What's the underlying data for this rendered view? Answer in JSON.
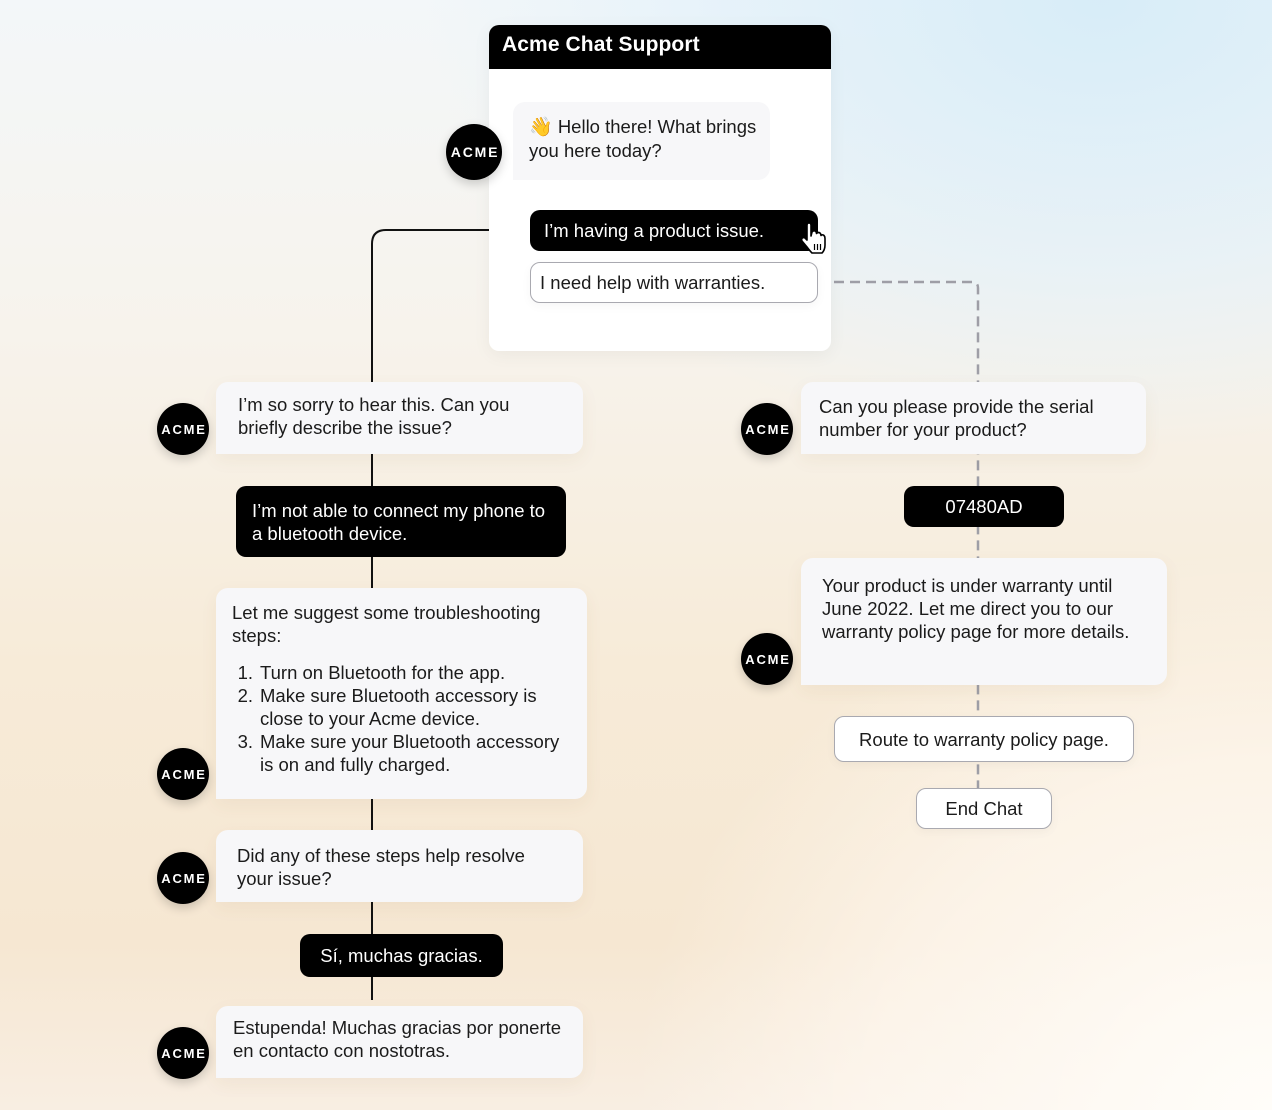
{
  "window": {
    "title": "Acme Chat Support"
  },
  "avatar_label": "ACME",
  "colors": {
    "user_bubble": "#000000",
    "bot_bubble": "#f7f7f9",
    "solid_connector": "#111111",
    "dashed_connector": "#9e9ea6"
  },
  "greeting": {
    "icon": "waving-hand-icon",
    "emoji": "👋",
    "text": "Hello there! What brings you here today?"
  },
  "options": {
    "product_issue": "I’m having a product issue.",
    "warranties": "I need help with warranties."
  },
  "product_branch": {
    "bot_1": "I’m so sorry to hear this. Can you briefly describe the issue?",
    "user_1": "I’m not able to connect my phone to a bluetooth device.",
    "bot_2": {
      "intro": "Let me suggest some troubleshooting steps:",
      "steps": [
        {
          "num": "1.",
          "text": "Turn on Bluetooth for the app."
        },
        {
          "num": "2.",
          "text": "Make sure Bluetooth accessory is close to your Acme device."
        },
        {
          "num": "3.",
          "text": "Make sure your Bluetooth accessory is on and fully charged."
        }
      ]
    },
    "bot_3": "Did any of these steps help resolve your issue?",
    "user_2": "Sí, muchas gracias.",
    "bot_4": "Estupenda! Muchas gracias por ponerte en contacto con nostotras."
  },
  "warranty_branch": {
    "bot_1": "Can you please provide the serial number for your product?",
    "user_1": "07480AD",
    "bot_2": "Your product is under warranty until June 2022. Let me direct you to our warranty policy page for more details.",
    "action_1": "Route to warranty policy page.",
    "action_2": "End Chat"
  }
}
